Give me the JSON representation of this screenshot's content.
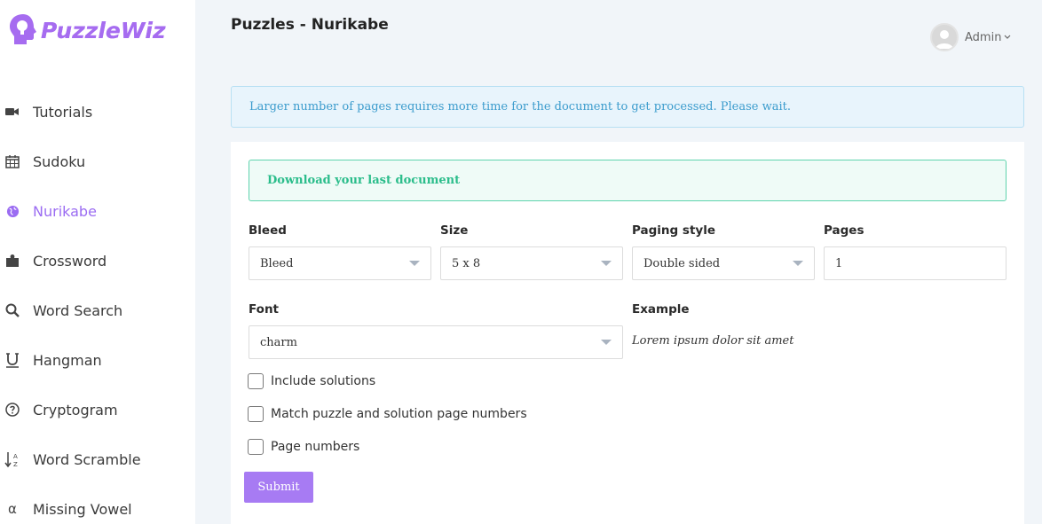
{
  "app": {
    "logo_text": "PuzzleWiz"
  },
  "sidebar": {
    "items": [
      {
        "label": "Tutorials",
        "icon": "video-camera-icon"
      },
      {
        "label": "Sudoku",
        "icon": "calendar-icon"
      },
      {
        "label": "Nurikabe",
        "icon": "globe-icon",
        "active": true
      },
      {
        "label": "Crossword",
        "icon": "puzzle-piece-icon"
      },
      {
        "label": "Word Search",
        "icon": "search-icon"
      },
      {
        "label": "Hangman",
        "icon": "underline-icon"
      },
      {
        "label": "Cryptogram",
        "icon": "question-circle-icon"
      },
      {
        "label": "Word Scramble",
        "icon": "sort-alpha-icon"
      },
      {
        "label": "Missing Vowel",
        "icon": "alpha-icon"
      }
    ]
  },
  "header": {
    "title": "Puzzles - Nurikabe",
    "user_name": "Admin"
  },
  "alerts": {
    "info": "Larger number of pages requires more time for the document to get processed. Please wait.",
    "success": "Download your last document"
  },
  "form": {
    "bleed": {
      "label": "Bleed",
      "value": "Bleed"
    },
    "size": {
      "label": "Size",
      "value": "5 x 8"
    },
    "paging_style": {
      "label": "Paging style",
      "value": "Double sided"
    },
    "pages": {
      "label": "Pages",
      "value": "1"
    },
    "font": {
      "label": "Font",
      "value": "charm"
    },
    "example": {
      "label": "Example",
      "text": "Lorem ipsum dolor sit amet"
    },
    "checkboxes": [
      {
        "label": "Include solutions",
        "checked": false
      },
      {
        "label": "Match puzzle and solution page numbers",
        "checked": false
      },
      {
        "label": "Page numbers",
        "checked": false
      }
    ],
    "submit_label": "Submit"
  },
  "colors": {
    "accent": "#9b6cf2",
    "info_bg": "#e8f4fc",
    "info_text": "#3c9ccd",
    "success_bg": "#effbf7",
    "success_text": "#2bbd8b",
    "page_bg": "#f1f5f9"
  }
}
